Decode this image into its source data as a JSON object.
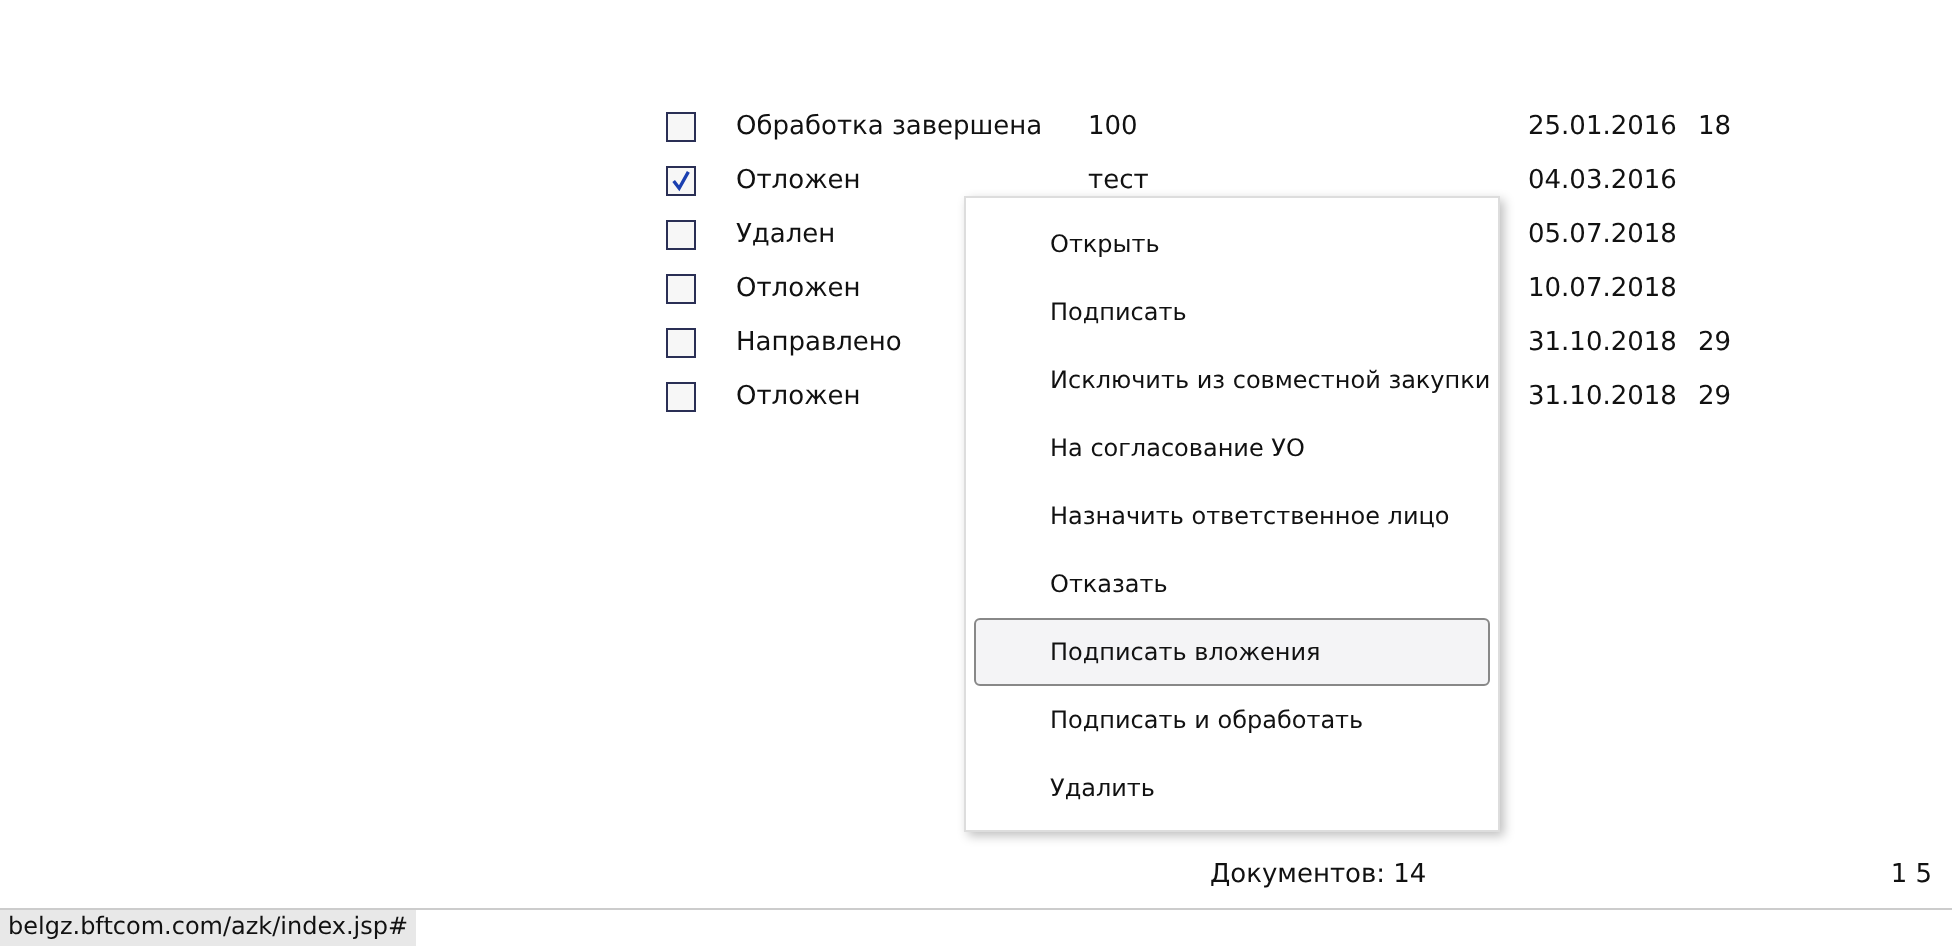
{
  "table": {
    "rows": [
      {
        "checked": false,
        "status": "Обработка завершена",
        "column_3": "100",
        "date": "25.01.2016",
        "column_5": "18"
      },
      {
        "checked": true,
        "status": "Отложен",
        "column_3": "тест",
        "date": "04.03.2016",
        "column_5": ""
      },
      {
        "checked": false,
        "status": "Удален",
        "column_3": "",
        "date": "05.07.2018",
        "column_5": ""
      },
      {
        "checked": false,
        "status": "Отложен",
        "column_3": "",
        "date": "10.07.2018",
        "column_5": ""
      },
      {
        "checked": false,
        "status": "Направлено",
        "column_3": "",
        "date": "31.10.2018",
        "column_5": "29"
      },
      {
        "checked": false,
        "status": "Отложен",
        "column_3": "",
        "date": "31.10.2018",
        "column_5": "29"
      }
    ]
  },
  "context_menu": {
    "items": [
      {
        "label": "Открыть",
        "selected": false
      },
      {
        "label": "Подписать",
        "selected": false
      },
      {
        "label": "Исключить из совместной закупки",
        "selected": false
      },
      {
        "label": "На согласование УО",
        "selected": false
      },
      {
        "label": "Назначить ответственное лицо",
        "selected": false
      },
      {
        "label": "Отказать",
        "selected": false
      },
      {
        "label": "Подписать вложения",
        "selected": true
      },
      {
        "label": "Подписать и обработать",
        "selected": false
      },
      {
        "label": "Удалить",
        "selected": false
      }
    ]
  },
  "footer": {
    "count": "Документов: 14",
    "pages": "1 5"
  },
  "status_bar": {
    "url": "belgz.bftcom.com/azk/index.jsp#"
  }
}
